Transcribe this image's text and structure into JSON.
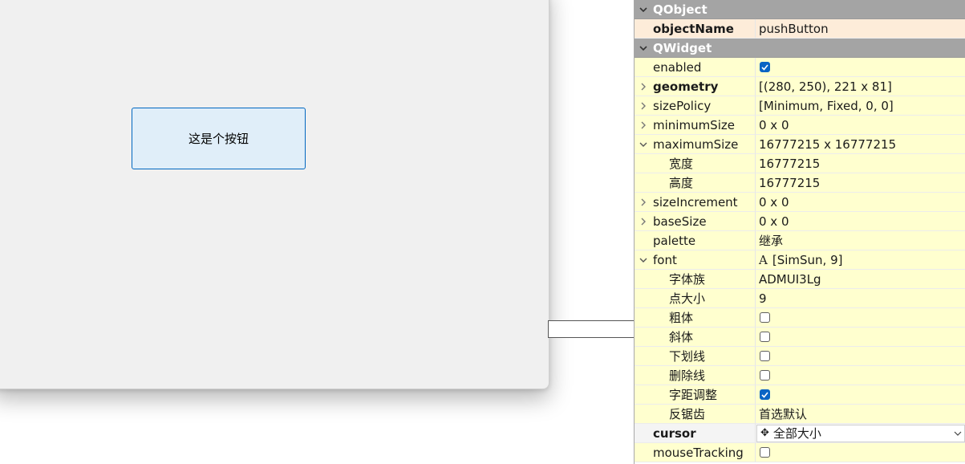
{
  "form": {
    "button_text": "这是个按钮"
  },
  "property_editor": {
    "sections": {
      "qobject": "QObject",
      "qwidget": "QWidget"
    },
    "rows": {
      "objectName": {
        "name": "objectName",
        "value": "pushButton"
      },
      "enabled": {
        "name": "enabled",
        "checked": true
      },
      "geometry": {
        "name": "geometry",
        "value": "[(280, 250), 221 x 81]"
      },
      "sizePolicy": {
        "name": "sizePolicy",
        "value": "[Minimum, Fixed, 0, 0]"
      },
      "minimumSize": {
        "name": "minimumSize",
        "value": "0 x 0"
      },
      "maximumSize": {
        "name": "maximumSize",
        "value": "16777215 x 16777215"
      },
      "max_width": {
        "name": "宽度",
        "value": "16777215"
      },
      "max_height": {
        "name": "高度",
        "value": "16777215"
      },
      "sizeIncrement": {
        "name": "sizeIncrement",
        "value": "0 x 0"
      },
      "baseSize": {
        "name": "baseSize",
        "value": "0 x 0"
      },
      "palette": {
        "name": "palette",
        "value": "继承"
      },
      "font": {
        "name": "font",
        "value": "[SimSun, 9]",
        "icon": "A"
      },
      "font_family": {
        "name": "字体族",
        "value": "ADMUI3Lg"
      },
      "point_size": {
        "name": "点大小",
        "value": "9"
      },
      "bold": {
        "name": "粗体",
        "checked": false
      },
      "italic": {
        "name": "斜体",
        "checked": false
      },
      "underline": {
        "name": "下划线",
        "checked": false
      },
      "strikeout": {
        "name": "删除线",
        "checked": false
      },
      "kerning": {
        "name": "字距调整",
        "checked": true
      },
      "antialiasing": {
        "name": "反锯齿",
        "value": "首选默认"
      },
      "cursor": {
        "name": "cursor",
        "value": "全部大小",
        "icon": "✥"
      },
      "mouseTracking": {
        "name": "mouseTracking",
        "checked": false
      }
    }
  },
  "colors": {
    "section_bg": "#a4a4a4",
    "row_yellow": "#ffffcf",
    "row_orange": "#fdecd9",
    "checkbox_on": "#0a64c4",
    "button_bg": "#e0eef9",
    "button_border": "#0067c0"
  }
}
